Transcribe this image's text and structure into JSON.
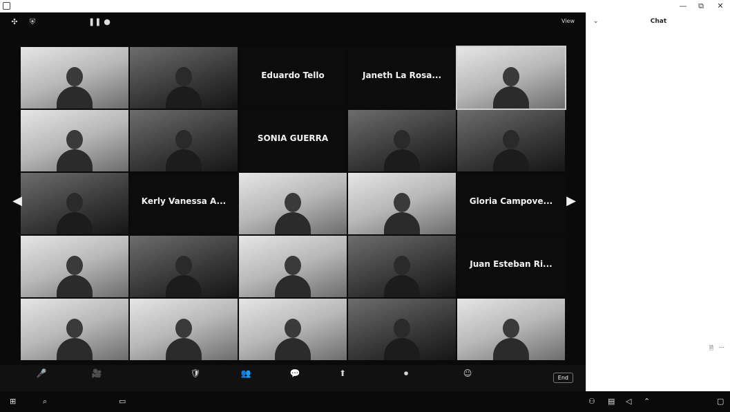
{
  "app": {
    "title": "",
    "controls": {
      "minimize": "—",
      "maximize": "⧉",
      "close": "✕"
    }
  },
  "topbar": {
    "viewing_label": "",
    "view_label": "View"
  },
  "participants": [
    {
      "name": "",
      "label": "",
      "video": true,
      "tone": "light"
    },
    {
      "name": "",
      "label": "",
      "video": true,
      "tone": "dark"
    },
    {
      "name": "Eduardo Tello",
      "label": "",
      "video": false
    },
    {
      "name": "Janeth La Rosa...",
      "label": "",
      "video": false
    },
    {
      "name": "",
      "label": "",
      "video": true,
      "tone": "light",
      "active": true
    },
    {
      "name": "",
      "label": "",
      "video": true,
      "tone": "light"
    },
    {
      "name": "",
      "label": "",
      "video": true,
      "tone": "dark"
    },
    {
      "name": "SONIA GUERRA",
      "label": "",
      "video": false
    },
    {
      "name": "",
      "label": "",
      "video": true,
      "tone": "dark"
    },
    {
      "name": "",
      "label": "",
      "video": true,
      "tone": "dark"
    },
    {
      "name": "",
      "label": "",
      "video": true,
      "tone": "dark"
    },
    {
      "name": "Kerly Vanessa A...",
      "label": "",
      "video": false
    },
    {
      "name": "",
      "label": "",
      "video": true,
      "tone": "light"
    },
    {
      "name": "",
      "label": "",
      "video": true,
      "tone": "light"
    },
    {
      "name": "Gloria Campove...",
      "label": "",
      "video": false
    },
    {
      "name": "",
      "label": "",
      "video": true,
      "tone": "light"
    },
    {
      "name": "",
      "label": "",
      "video": true,
      "tone": "dark"
    },
    {
      "name": "",
      "label": "",
      "video": true,
      "tone": "light"
    },
    {
      "name": "",
      "label": "",
      "video": true,
      "tone": "dark"
    },
    {
      "name": "Juan Esteban Ri...",
      "label": "",
      "video": false
    },
    {
      "name": "",
      "label": "",
      "video": true,
      "tone": "light"
    },
    {
      "name": "",
      "label": "",
      "video": true,
      "tone": "light"
    },
    {
      "name": "",
      "label": "",
      "video": true,
      "tone": "light"
    },
    {
      "name": "",
      "label": "",
      "video": true,
      "tone": "dark"
    },
    {
      "name": "",
      "label": "",
      "video": true,
      "tone": "light"
    }
  ],
  "toolbar": {
    "items": [
      {
        "icon": "🎤",
        "label": ""
      },
      {
        "icon": "🎥",
        "label": ""
      },
      {
        "icon": "🛡",
        "label": ""
      },
      {
        "icon": "👥",
        "label": ""
      },
      {
        "icon": "💬",
        "label": ""
      },
      {
        "icon": "⬆",
        "label": ""
      },
      {
        "icon": "⏺",
        "label": ""
      },
      {
        "icon": "☺",
        "label": ""
      }
    ],
    "end_label": "End"
  },
  "chat": {
    "title": "Chat",
    "collapse_icon": "⌄",
    "messages": [
      {
        "from": "",
        "text": ""
      },
      {
        "from": "",
        "text": ""
      },
      {
        "from": "",
        "text": ""
      },
      {
        "from": "",
        "text": ""
      },
      {
        "from": "",
        "text": ""
      }
    ],
    "notice": "",
    "to_label": "",
    "recipient": "",
    "input_placeholder": ""
  },
  "taskbar": {
    "time": "",
    "date": ""
  }
}
